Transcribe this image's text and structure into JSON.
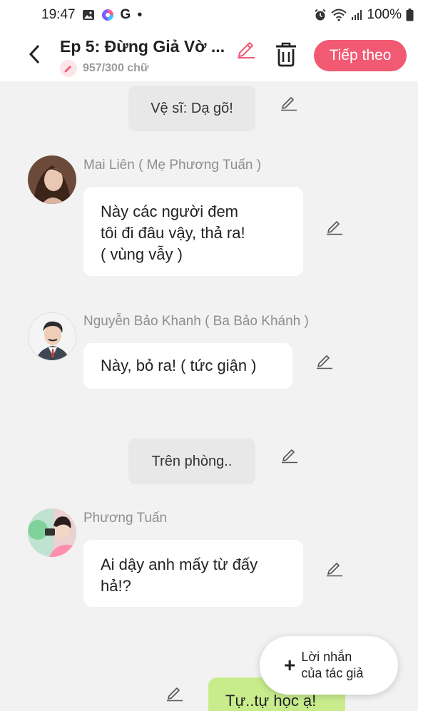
{
  "status_bar": {
    "time": "19:47",
    "battery": "100%",
    "icons": [
      "gallery-icon",
      "color-wheel-icon",
      "google-icon",
      "dot-icon",
      "alarm-icon",
      "wifi-icon",
      "signal-icon",
      "battery-icon"
    ]
  },
  "header": {
    "title": "Ep 5: Đừng Giả Vờ ...",
    "word_count": "957/300 chữ",
    "next_label": "Tiếp theo"
  },
  "colors": {
    "accent": "#f25a73",
    "bubble": "#ffffff",
    "narration_bg": "#e8e8e8",
    "own_bubble": "#c8ec8c",
    "background": "#f2f2f2"
  },
  "messages": [
    {
      "type": "narration",
      "text": "Vệ sĩ: Dạ gõ!"
    },
    {
      "type": "speech",
      "speaker": "Mai Liên ( Mẹ Phương Tuấn )",
      "lines": [
        "Này các người đem",
        "tôi đi đâu vậy, thả ra!",
        "( vùng vẫy )"
      ]
    },
    {
      "type": "speech",
      "speaker": "Nguyễn Bảo Khanh ( Ba Bảo Khánh )",
      "lines": [
        "Này, bỏ ra! ( tức giận )"
      ]
    },
    {
      "type": "narration",
      "text": "Trên phòng.."
    },
    {
      "type": "speech",
      "speaker": "Phương Tuấn",
      "lines": [
        "Ai dậy anh mấy từ đấy",
        "hả!?"
      ]
    },
    {
      "type": "own",
      "text": "Tự..tự học ạ!"
    }
  ],
  "author_note": {
    "plus": "+",
    "line1": "Lời nhắn",
    "line2": "của tác giả"
  }
}
